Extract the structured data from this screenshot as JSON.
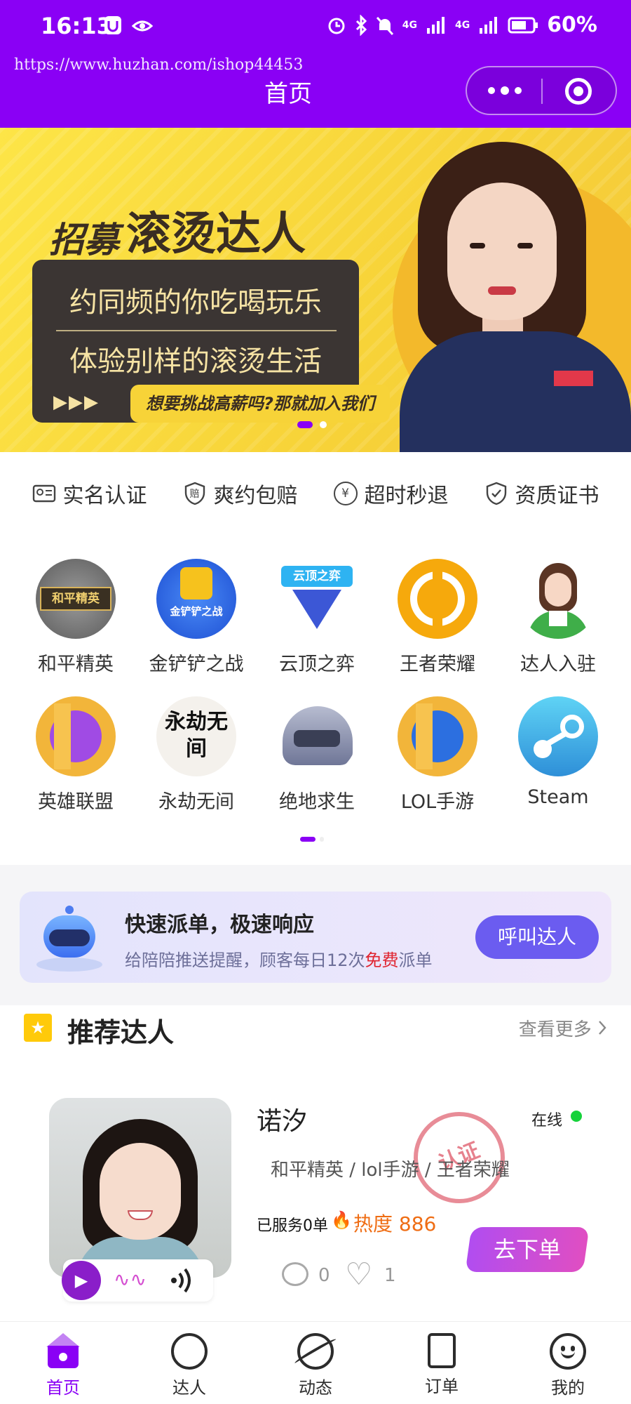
{
  "status_bar": {
    "time": "16:13",
    "battery": "60%",
    "signal_1": "4G",
    "signal_2": "4G"
  },
  "nav": {
    "title": "首页",
    "url_watermark": "https://www.huzhan.com/ishop44453"
  },
  "banner": {
    "headline_small": "招募",
    "headline_big": "滚烫达人",
    "line_1": "约同频的你吃喝玩乐",
    "line_2": "体验别样的滚烫生活",
    "tagline": "想要挑战高薪吗?那就加入我们",
    "arrows": "▶▶▶",
    "page_index": 1,
    "page_count": 2
  },
  "guarantees": [
    {
      "icon": "id-card-icon",
      "label": "实名认证"
    },
    {
      "icon": "compensation-shield-icon",
      "icon_text": "赔",
      "label": "爽约包赔"
    },
    {
      "icon": "refund-icon",
      "icon_text": "¥",
      "label": "超时秒退"
    },
    {
      "icon": "certificate-shield-icon",
      "label": "资质证书"
    }
  ],
  "categories": [
    {
      "label": "和平精英",
      "icon": "peace-elite-icon",
      "icon_text": "和平精英"
    },
    {
      "label": "金铲铲之战",
      "icon": "golden-spatula-icon",
      "icon_text": "金铲铲之战"
    },
    {
      "label": "云顶之弈",
      "icon": "teamfight-tactics-icon",
      "icon_text": "云顶之弈"
    },
    {
      "label": "王者荣耀",
      "icon": "honor-of-kings-icon"
    },
    {
      "label": "达人入驻",
      "icon": "talent-join-icon"
    },
    {
      "label": "英雄联盟",
      "icon": "league-of-legends-icon"
    },
    {
      "label": "永劫无间",
      "icon": "naraka-icon",
      "icon_text": "永劫无间"
    },
    {
      "label": "绝地求生",
      "icon": "pubg-helmet-icon"
    },
    {
      "label": "LOL手游",
      "icon": "lol-mobile-icon"
    },
    {
      "label": "Steam",
      "icon": "steam-icon"
    }
  ],
  "promo": {
    "title": "快速派单，极速响应",
    "subtitle_pre": "给陪陪推送提醒，顾客每日12次",
    "subtitle_free": "免费",
    "subtitle_post": "派单",
    "button": "呼叫达人"
  },
  "recommend": {
    "title": "推荐达人",
    "see_more": "查看更多",
    "star_glyph": "★"
  },
  "talent": {
    "name": "诺汐",
    "status": "在线",
    "games": "和平精英 / lol手游 / 王者荣耀",
    "stamp": "认证",
    "served": "已服务0单",
    "heat": "热度 886",
    "order_button": "去下单",
    "comments": "0",
    "likes": "1"
  },
  "tabbar": [
    {
      "label": "首页",
      "icon": "home-icon",
      "active": true
    },
    {
      "label": "达人",
      "icon": "chat-bubble-icon",
      "active": false
    },
    {
      "label": "动态",
      "icon": "planet-icon",
      "active": false
    },
    {
      "label": "订单",
      "icon": "clipboard-icon",
      "active": false
    },
    {
      "label": "我的",
      "icon": "smiley-icon",
      "active": false
    }
  ],
  "colors": {
    "brand": "#8a00f5",
    "accent": "#6b5cf0",
    "heat": "#ef6d14",
    "online": "#16d23b"
  }
}
